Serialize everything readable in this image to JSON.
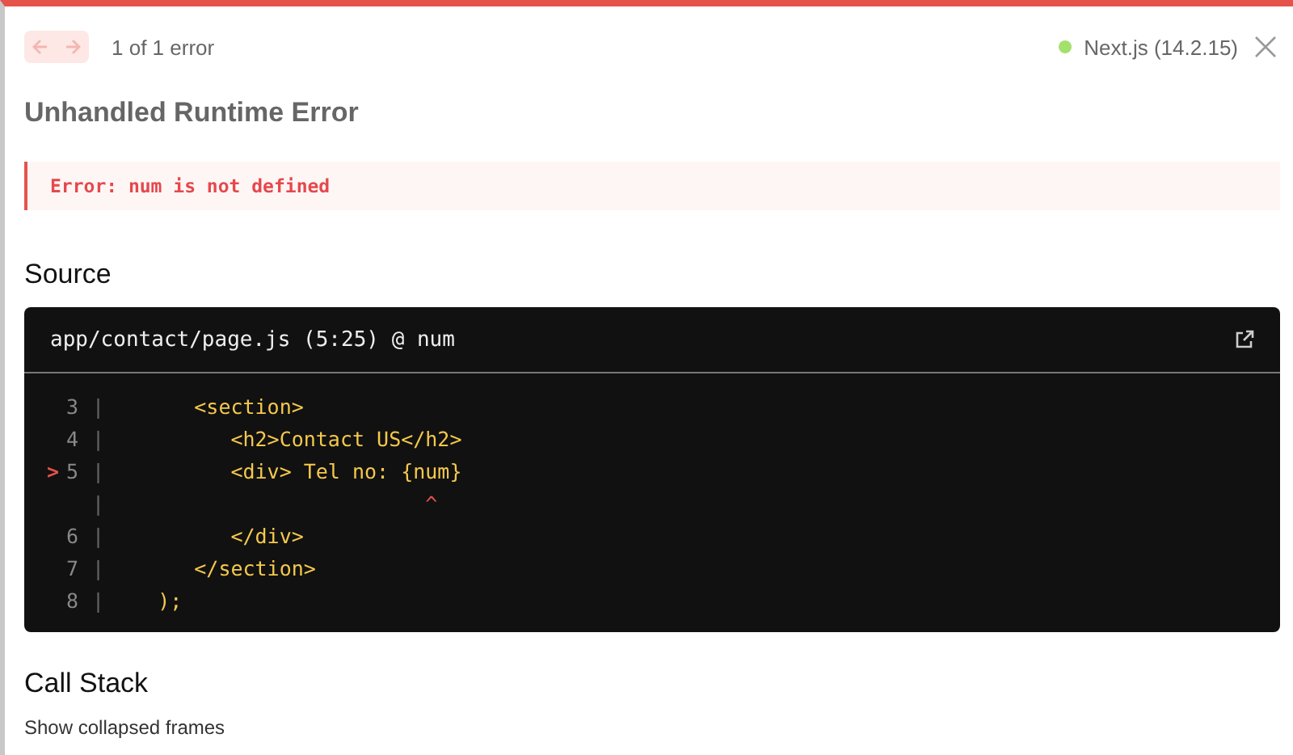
{
  "nav": {
    "prev_disabled": true,
    "next_disabled": true,
    "counter": "1 of 1 error"
  },
  "version": {
    "label": "Next.js (14.2.15)",
    "color": "#a3e06c"
  },
  "title": "Unhandled Runtime Error",
  "error_message": "Error: num is not defined",
  "source": {
    "heading": "Source",
    "file": "app/contact/page.js (5:25) @ num",
    "lines": [
      {
        "kind": "code",
        "number": "3",
        "gutter": "|",
        "text": "      <section>"
      },
      {
        "kind": "code",
        "number": "4",
        "gutter": "|",
        "text": "         <h2>Contact US</h2>"
      },
      {
        "kind": "code",
        "marker": ">",
        "number": "5",
        "gutter": "|",
        "text": "         <div> Tel no: {num}"
      },
      {
        "kind": "caret",
        "gutter": "|",
        "text": "                         ^"
      },
      {
        "kind": "code",
        "number": "6",
        "gutter": "|",
        "text": "         </div>"
      },
      {
        "kind": "code",
        "number": "7",
        "gutter": "|",
        "text": "      </section>"
      },
      {
        "kind": "code",
        "number": "8",
        "gutter": "|",
        "text": "   );"
      }
    ]
  },
  "call_stack": {
    "heading": "Call Stack",
    "toggle": "Show collapsed frames"
  }
}
